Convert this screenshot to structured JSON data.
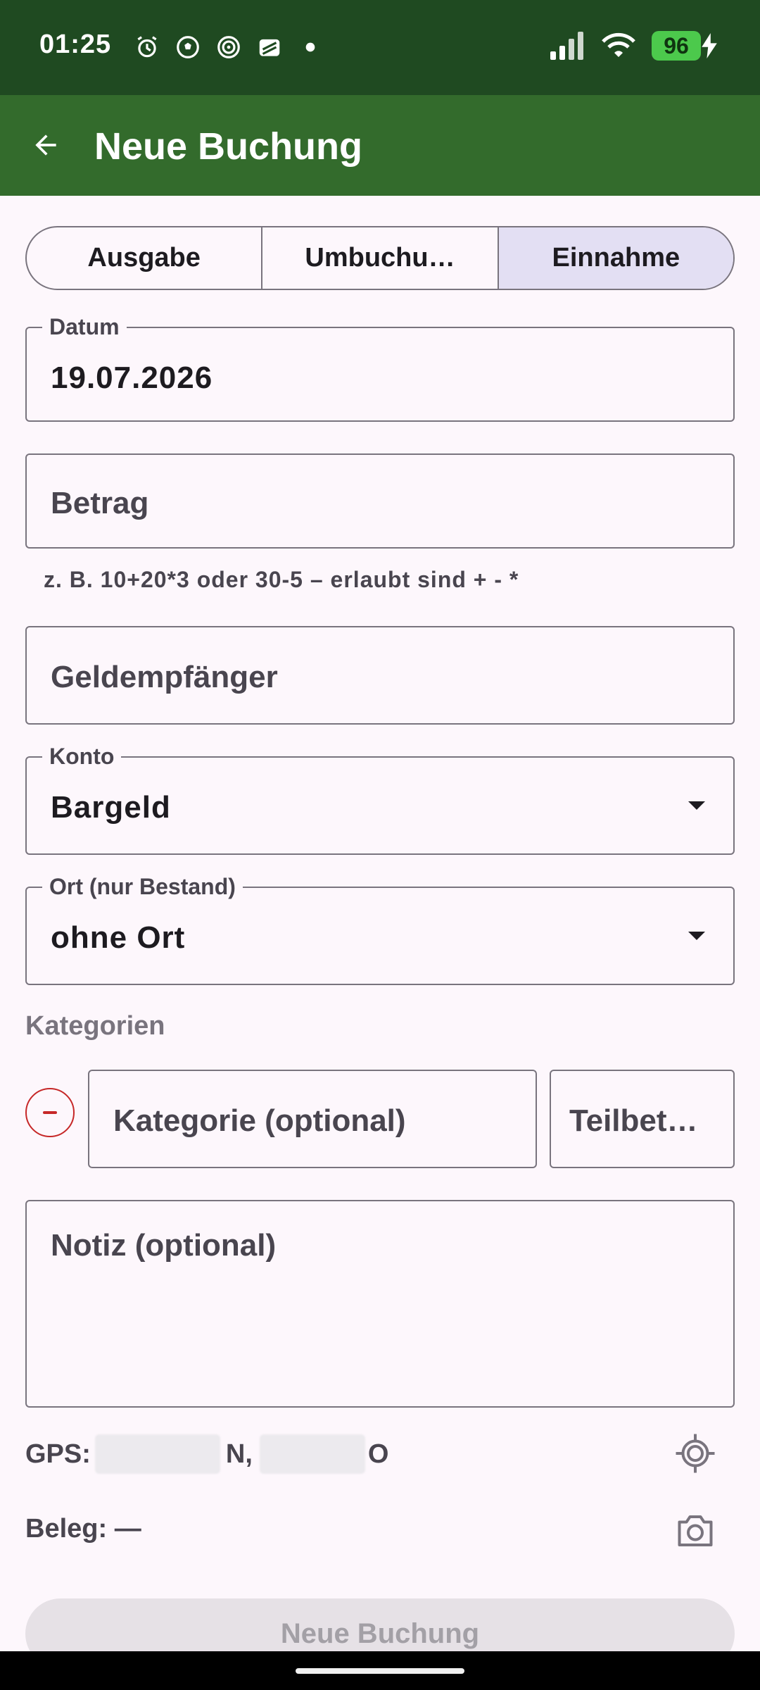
{
  "status_bar": {
    "time": "01:25",
    "battery": "96",
    "icons": [
      "alarm-icon",
      "soccer-ball-icon",
      "spiral-icon",
      "app-icon",
      "dot-icon",
      "signal-icon",
      "wifi-icon",
      "charging-icon"
    ]
  },
  "app_bar": {
    "title": "Neue Buchung",
    "back_icon": "arrow-back-icon"
  },
  "type_selector": {
    "options": [
      "Ausgabe",
      "Umbuchu…",
      "Einnahme"
    ],
    "selected": "Einnahme"
  },
  "form": {
    "datum": {
      "label": "Datum",
      "value": "19.07.2026"
    },
    "betrag": {
      "placeholder": "Betrag",
      "helper": "z. B. 10+20*3 oder 30-5 – erlaubt sind + - *"
    },
    "geldempfaenger": {
      "placeholder": "Geldempfänger"
    },
    "konto": {
      "label": "Konto",
      "value": "Bargeld"
    },
    "ort": {
      "label": "Ort (nur Bestand)",
      "value": "ohne Ort"
    },
    "kategorien": {
      "title": "Kategorien",
      "kategorie_placeholder": "Kategorie (optional)",
      "teilbetrag_placeholder": "Teilbet…"
    },
    "notiz": {
      "placeholder": "Notiz (optional)"
    }
  },
  "gps": {
    "label": "GPS:",
    "lat_suffix": "N,",
    "lon_suffix": "O"
  },
  "beleg": {
    "label": "Beleg: —"
  },
  "submit": {
    "label": "Neue Buchung"
  },
  "colors": {
    "status_bar": "#1f4a21",
    "app_bar": "#336b2c",
    "selected_segment": "#e3dff3",
    "remove": "#c62828",
    "background": "#fdf7fc"
  }
}
